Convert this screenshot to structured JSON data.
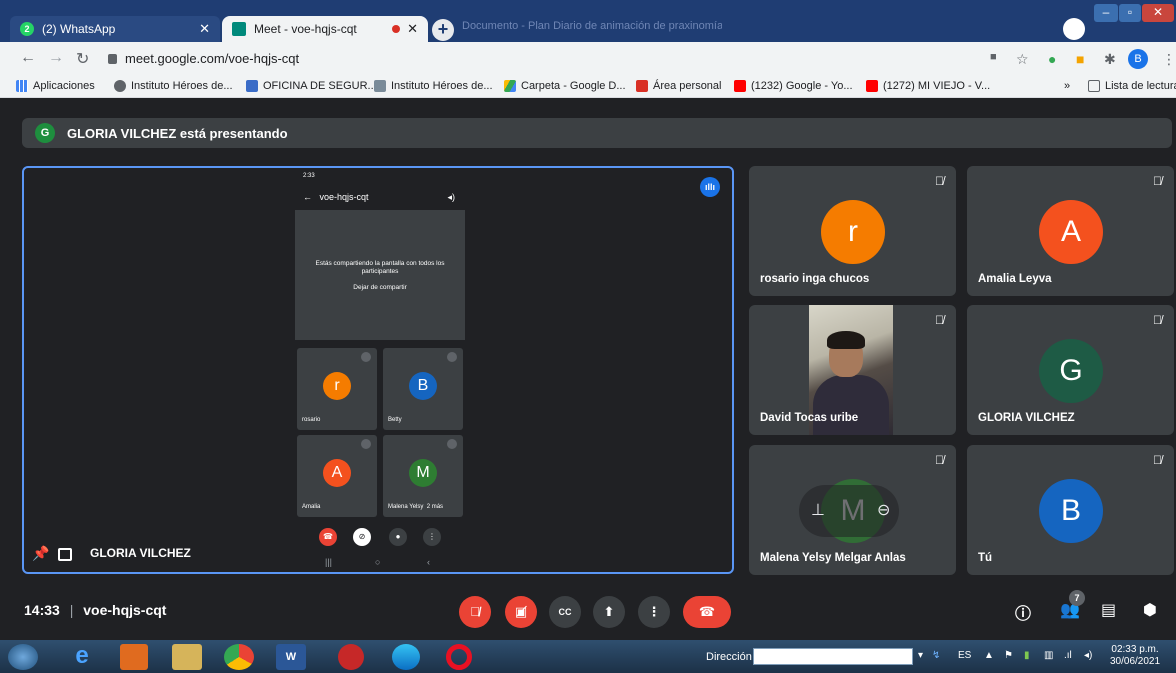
{
  "browser": {
    "tabs": [
      {
        "title": "(2) WhatsApp",
        "badge": "2"
      },
      {
        "title": "Meet - voe-hqjs-cqt"
      }
    ],
    "background_tab": "Documento - Plan Diario de animación de praxinomía",
    "url": "meet.google.com/voe-hqjs-cqt",
    "profile_initial": "B",
    "bookmarks": [
      {
        "label": "Aplicaciones",
        "icon": "apps-grid-icon"
      },
      {
        "label": "Instituto Héroes de...",
        "icon": "globe-icon"
      },
      {
        "label": "OFICINA DE SEGUR...",
        "icon": "people-icon"
      },
      {
        "label": "Instituto Héroes de...",
        "icon": "shield-icon"
      },
      {
        "label": "Carpeta - Google D...",
        "icon": "drive-icon"
      },
      {
        "label": "Área personal",
        "icon": "moodle-icon"
      },
      {
        "label": "(1232) Google - Yo...",
        "icon": "youtube-icon"
      },
      {
        "label": "(1272) MI VIEJO - V...",
        "icon": "youtube-icon"
      }
    ],
    "bookmarks_more": "»",
    "reading_list": "Lista de lectura"
  },
  "meet": {
    "presenting_initial": "G",
    "presenting_text": "GLORIA VILCHEZ está presentando",
    "presenter_name": "GLORIA VILCHEZ",
    "meeting_code": "voe-hqjs-cqt",
    "time": "14:33",
    "people_count": "7",
    "phone": {
      "status_time": "2:33",
      "code": "voe-hqjs-cqt",
      "share_text": "Estás compartiendo la pantalla con todos los participantes",
      "stop_share": "Dejar de compartir",
      "tiles": [
        {
          "initial": "r",
          "name": "rosario",
          "color": "#f57c00"
        },
        {
          "initial": "B",
          "name": "Betty",
          "color": "#1565c0"
        },
        {
          "initial": "A",
          "name": "Amalia",
          "color": "#f4511e"
        },
        {
          "initial": "M",
          "name": "Malena Yelsy",
          "color": "#2e7d32"
        }
      ],
      "more": "2 más"
    },
    "participants": [
      {
        "initial": "r",
        "name": "rosario inga chucos",
        "color": "#f57c00"
      },
      {
        "initial": "A",
        "name": "Amalia Leyva",
        "color": "#f4511e"
      },
      {
        "initial": "",
        "name": "David Tocas uribe",
        "color": ""
      },
      {
        "initial": "G",
        "name": "GLORIA VILCHEZ",
        "color": "#1e5b45"
      },
      {
        "initial": "M",
        "name": "Malena Yelsy Melgar Anlas",
        "color": "#2e7d32"
      },
      {
        "initial": "B",
        "name": "Tú",
        "color": "#1565c0"
      }
    ]
  },
  "taskbar": {
    "address_label": "Dirección",
    "lang": "ES",
    "clock_time": "02:33 p.m.",
    "clock_date": "30/06/2021"
  }
}
